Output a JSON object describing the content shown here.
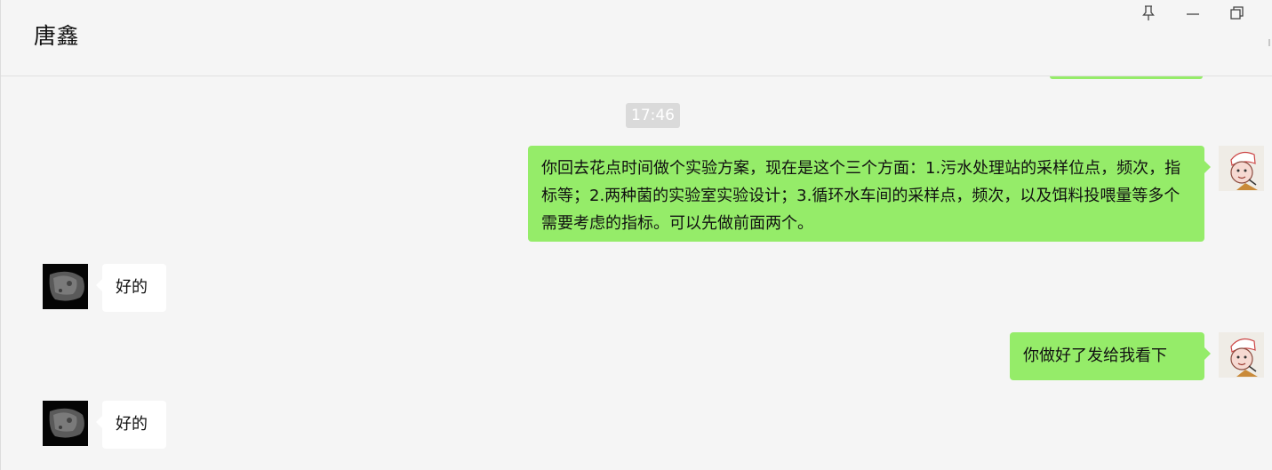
{
  "header": {
    "title": "唐鑫"
  },
  "window_controls": {
    "pin_icon": "pin-icon",
    "minimize_icon": "minimize-icon",
    "restore_icon": "restore-icon"
  },
  "messages": {
    "time_divider": "17:46",
    "items": [
      {
        "sender": "self",
        "text": "你回去花点时间做个实验方案，现在是这个三个方面：1.污水处理站的采样位点，频次，指标等；2.两种菌的实验室实验设计；3.循环水车间的采样点，频次，以及饵料投喂量等多个需要考虑的指标。可以先做前面两个。"
      },
      {
        "sender": "other",
        "text": "好的"
      },
      {
        "sender": "self",
        "text": "你做好了发给我看下"
      },
      {
        "sender": "other",
        "text": "好的"
      }
    ]
  },
  "colors": {
    "self_bubble": "#95ec69",
    "other_bubble": "#ffffff",
    "background": "#f5f5f5",
    "time_badge": "#dadada"
  }
}
